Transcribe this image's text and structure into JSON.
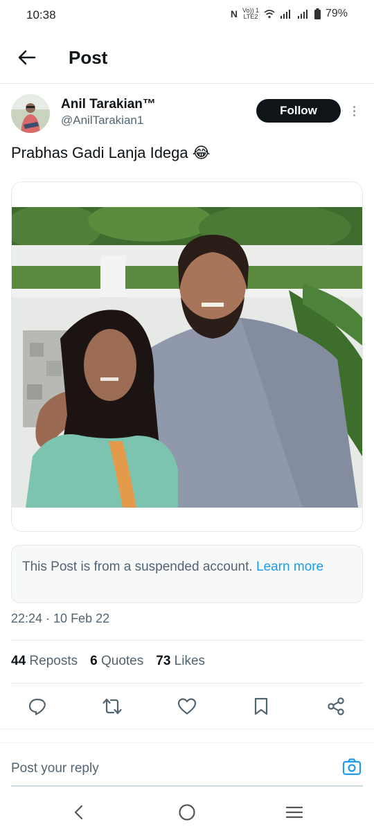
{
  "status_bar": {
    "time": "10:38",
    "network_top": "Vo)) 1",
    "network_bottom": "LTE2",
    "battery": "79%",
    "icons": [
      "nfc-icon",
      "wifi-icon",
      "signal-icon",
      "signal-icon",
      "battery-icon"
    ]
  },
  "header": {
    "title": "Post",
    "back_icon": "arrow-left-icon"
  },
  "author": {
    "name": "Anil Tarakian™",
    "handle": "@AnilTarakian1",
    "follow_label": "Follow"
  },
  "post": {
    "text": "Prabhas Gadi Lanja Idega 😂"
  },
  "notice": {
    "text": "This Post is from a suspended account. ",
    "link": "Learn more"
  },
  "meta": {
    "timestamp": "22:24 · 10 Feb 22"
  },
  "stats": {
    "reposts_count": "44",
    "reposts_label": "Reposts",
    "quotes_count": "6",
    "quotes_label": "Quotes",
    "likes_count": "73",
    "likes_label": "Likes"
  },
  "actions": [
    "reply-icon",
    "repost-icon",
    "like-icon",
    "bookmark-icon",
    "share-icon"
  ],
  "reply": {
    "placeholder": "Post your reply"
  },
  "colors": {
    "accent": "#1d9bf0",
    "text": "#0f1419",
    "secondary": "#536471",
    "border": "#e6e9ec"
  }
}
